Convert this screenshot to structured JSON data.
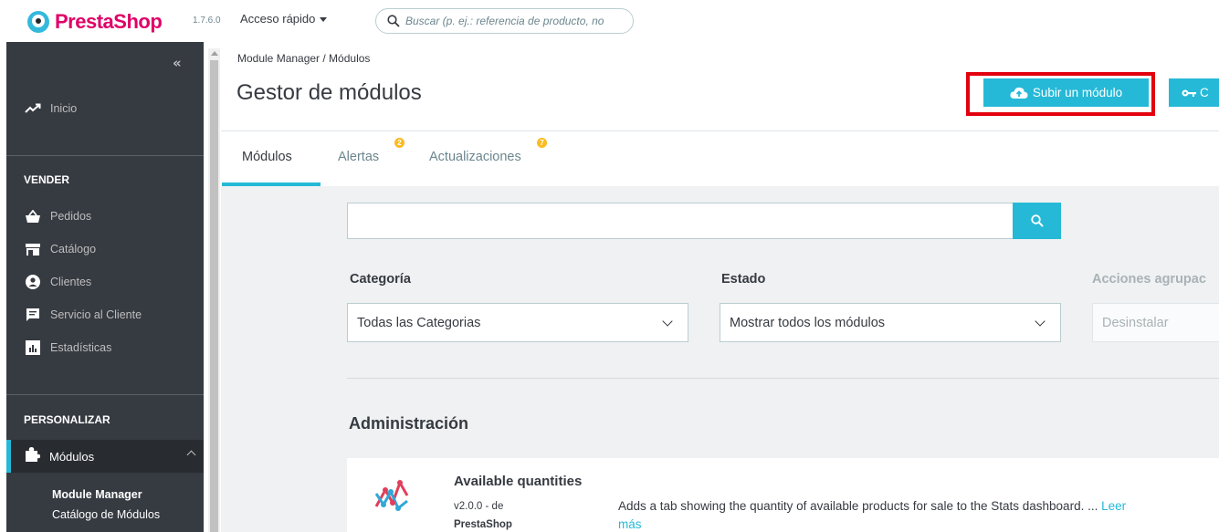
{
  "topbar": {
    "logo_text": "PrestaShop",
    "version": "1.7.6.0",
    "quick_access": "Acceso rápido",
    "search_placeholder": "Buscar (p. ej.: referencia de producto, no"
  },
  "sidebar": {
    "home": "Inicio",
    "section_sell": "VENDER",
    "sell_items": [
      "Pedidos",
      "Catálogo",
      "Clientes",
      "Servicio al Cliente",
      "Estadísticas"
    ],
    "section_customize": "PERSONALIZAR",
    "active_item": "Módulos",
    "sub_items": [
      "Module Manager",
      "Catálogo de Módulos"
    ]
  },
  "header": {
    "breadcrumb": "Module Manager / Módulos",
    "title": "Gestor de módulos",
    "upload_button": "Subir un módulo",
    "connect_button": "C"
  },
  "tabs": [
    {
      "label": "Módulos",
      "badge": ""
    },
    {
      "label": "Alertas",
      "badge": "2"
    },
    {
      "label": "Actualizaciones",
      "badge": "7"
    }
  ],
  "filters": {
    "category_label": "Categoría",
    "category_value": "Todas las Categorias",
    "status_label": "Estado",
    "status_value": "Mostrar todos los módulos",
    "bulk_label": "Acciones agrupac",
    "bulk_value": "Desinstalar"
  },
  "section": {
    "title": "Administración"
  },
  "module": {
    "name": "Available quantities",
    "version": "v2.0.0 - de",
    "author": "PrestaShop",
    "description": "Adds a tab showing the quantity of available products for sale to the Stats dashboard. ... ",
    "read_more": "Leer más"
  },
  "colors": {
    "accent": "#25b9d7",
    "sidebar": "#363a41",
    "highlight": "#e2000f",
    "brand": "#df0067"
  }
}
